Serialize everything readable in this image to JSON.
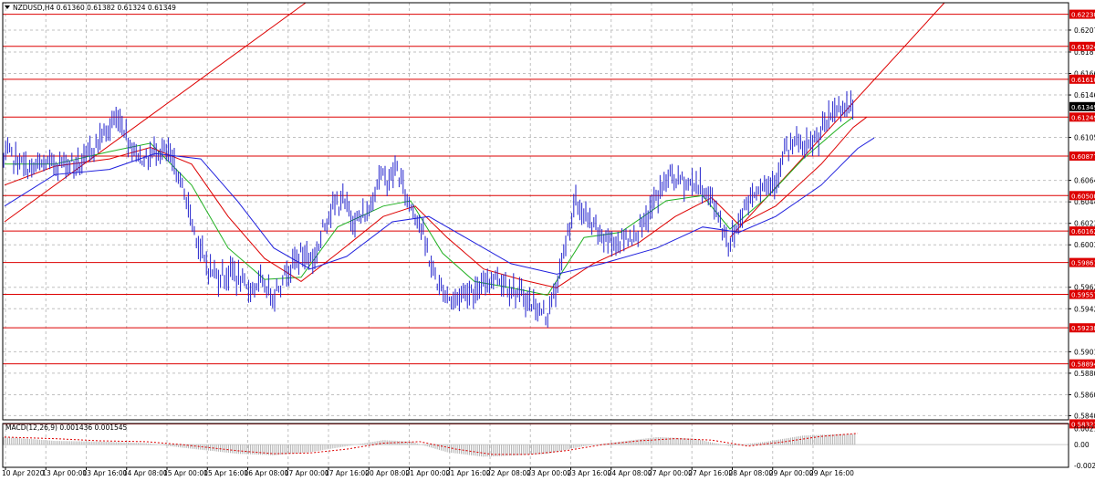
{
  "header": {
    "symbol_line": "NZDUSD,H4  0.61360 0.61382 0.61324 0.61349",
    "macd_label": "MACD(12,26,9) 0.001436 0.001545"
  },
  "colors": {
    "grid": "#c0c0c0",
    "price": "#2222cc",
    "resistance": "#dd0000",
    "ma_fast": "#20b020",
    "ma_mid": "#dd0000",
    "ma_slow": "#2020dd",
    "current_tag": "#000000",
    "macd_hist": "#b0b0b0",
    "macd_signal": "#dd0000"
  },
  "chart_data": [
    {
      "type": "line",
      "title": "NZDUSD,H4",
      "ylim": [
        0.5836,
        0.6234
      ],
      "y_ticks": [
        "0.62079",
        "0.61870",
        "0.61665",
        "0.61460",
        "0.61055",
        "0.60645",
        "0.60440",
        "0.60235",
        "0.60030",
        "0.59625",
        "0.59420",
        "0.59010",
        "0.58805",
        "0.58600",
        "0.58400"
      ],
      "horizontal_levels": [
        "0.62230",
        "0.61924",
        "0.61610",
        "0.61249",
        "0.60877",
        "0.60500",
        "0.60162",
        "0.59861",
        "0.59557",
        "0.59238",
        "0.58894",
        "0.58322"
      ],
      "current_price": "0.61349",
      "x_labels": [
        "10 Apr 2020",
        "13 Apr 00:00",
        "13 Apr 16:00",
        "14 Apr 08:00",
        "15 Apr 00:00",
        "15 Apr 16:00",
        "16 Apr 08:00",
        "17 Apr 00:00",
        "17 Apr 16:00",
        "20 Apr 08:00",
        "21 Apr 00:00",
        "21 Apr 16:00",
        "22 Apr 08:00",
        "23 Apr 00:00",
        "23 Apr 16:00",
        "24 Apr 08:00",
        "27 Apr 00:00",
        "27 Apr 16:00",
        "28 Apr 08:00",
        "29 Apr 00:00",
        "29 Apr 16:00"
      ],
      "price_anchors": [
        [
          0,
          0.608
        ],
        [
          10,
          0.609
        ],
        [
          30,
          0.6075
        ],
        [
          50,
          0.608
        ],
        [
          70,
          0.6082
        ],
        [
          90,
          0.608
        ],
        [
          105,
          0.61
        ],
        [
          120,
          0.6115
        ],
        [
          130,
          0.6125
        ],
        [
          145,
          0.6095
        ],
        [
          160,
          0.6083
        ],
        [
          172,
          0.6095
        ],
        [
          185,
          0.6088
        ],
        [
          200,
          0.606
        ],
        [
          212,
          0.602
        ],
        [
          225,
          0.5985
        ],
        [
          240,
          0.5972
        ],
        [
          255,
          0.5978
        ],
        [
          270,
          0.596
        ],
        [
          285,
          0.5967
        ],
        [
          300,
          0.5955
        ],
        [
          315,
          0.598
        ],
        [
          330,
          0.5995
        ],
        [
          345,
          0.599
        ],
        [
          360,
          0.6035
        ],
        [
          375,
          0.6045
        ],
        [
          390,
          0.6025
        ],
        [
          405,
          0.6035
        ],
        [
          415,
          0.607
        ],
        [
          425,
          0.6065
        ],
        [
          435,
          0.6075
        ],
        [
          445,
          0.605
        ],
        [
          460,
          0.6025
        ],
        [
          470,
          0.599
        ],
        [
          480,
          0.5965
        ],
        [
          495,
          0.595
        ],
        [
          510,
          0.596
        ],
        [
          525,
          0.5958
        ],
        [
          540,
          0.5975
        ],
        [
          555,
          0.5965
        ],
        [
          570,
          0.5955
        ],
        [
          585,
          0.5945
        ],
        [
          598,
          0.5935
        ],
        [
          610,
          0.596
        ],
        [
          620,
          0.6005
        ],
        [
          630,
          0.6045
        ],
        [
          640,
          0.603
        ],
        [
          655,
          0.6015
        ],
        [
          670,
          0.6005
        ],
        [
          690,
          0.601
        ],
        [
          705,
          0.602
        ],
        [
          720,
          0.605
        ],
        [
          735,
          0.607
        ],
        [
          750,
          0.6063
        ],
        [
          765,
          0.606
        ],
        [
          780,
          0.6048
        ],
        [
          790,
          0.6023
        ],
        [
          800,
          0.6003
        ],
        [
          812,
          0.603
        ],
        [
          822,
          0.605
        ],
        [
          835,
          0.606
        ],
        [
          850,
          0.6065
        ],
        [
          860,
          0.609
        ],
        [
          872,
          0.61
        ],
        [
          885,
          0.6095
        ],
        [
          897,
          0.6105
        ],
        [
          910,
          0.6125
        ],
        [
          920,
          0.6135
        ],
        [
          935,
          0.6134
        ]
      ],
      "moving_averages": {
        "fast": [
          [
            5,
            0.608
          ],
          [
            60,
            0.608
          ],
          [
            120,
            0.6092
          ],
          [
            165,
            0.61
          ],
          [
            210,
            0.606
          ],
          [
            250,
            0.6
          ],
          [
            290,
            0.597
          ],
          [
            330,
            0.5972
          ],
          [
            370,
            0.602
          ],
          [
            420,
            0.604
          ],
          [
            450,
            0.6045
          ],
          [
            485,
            0.5995
          ],
          [
            520,
            0.5968
          ],
          [
            560,
            0.5962
          ],
          [
            600,
            0.5955
          ],
          [
            640,
            0.601
          ],
          [
            680,
            0.6015
          ],
          [
            730,
            0.6045
          ],
          [
            770,
            0.605
          ],
          [
            800,
            0.6018
          ],
          [
            840,
            0.6048
          ],
          [
            880,
            0.6085
          ],
          [
            920,
            0.6115
          ],
          [
            935,
            0.6125
          ]
        ],
        "mid": [
          [
            5,
            0.606
          ],
          [
            60,
            0.6078
          ],
          [
            120,
            0.6085
          ],
          [
            165,
            0.6096
          ],
          [
            210,
            0.608
          ],
          [
            250,
            0.603
          ],
          [
            290,
            0.599
          ],
          [
            330,
            0.5968
          ],
          [
            370,
            0.5995
          ],
          [
            420,
            0.603
          ],
          [
            455,
            0.604
          ],
          [
            490,
            0.601
          ],
          [
            530,
            0.598
          ],
          [
            570,
            0.597
          ],
          [
            610,
            0.5962
          ],
          [
            650,
            0.5985
          ],
          [
            700,
            0.6005
          ],
          [
            740,
            0.603
          ],
          [
            780,
            0.6048
          ],
          [
            810,
            0.6022
          ],
          [
            850,
            0.604
          ],
          [
            900,
            0.608
          ],
          [
            935,
            0.6115
          ],
          [
            950,
            0.6125
          ]
        ],
        "slow": [
          [
            5,
            0.604
          ],
          [
            60,
            0.607
          ],
          [
            120,
            0.6075
          ],
          [
            170,
            0.609
          ],
          [
            220,
            0.6085
          ],
          [
            260,
            0.6045
          ],
          [
            300,
            0.6
          ],
          [
            340,
            0.598
          ],
          [
            380,
            0.5992
          ],
          [
            430,
            0.6025
          ],
          [
            470,
            0.603
          ],
          [
            510,
            0.601
          ],
          [
            560,
            0.5985
          ],
          [
            610,
            0.5975
          ],
          [
            660,
            0.5985
          ],
          [
            720,
            0.6
          ],
          [
            770,
            0.602
          ],
          [
            810,
            0.6015
          ],
          [
            850,
            0.603
          ],
          [
            900,
            0.606
          ],
          [
            940,
            0.6095
          ],
          [
            958,
            0.6105
          ]
        ]
      },
      "trendlines": [
        {
          "from": [
            5,
            0.6025
          ],
          "to": [
            335,
            0.6234
          ]
        },
        {
          "from": [
            800,
            0.601
          ],
          "to": [
            1035,
            0.6234
          ]
        }
      ]
    },
    {
      "type": "bar",
      "title": "MACD(12,26,9)",
      "ylim": [
        -0.003,
        0.0028
      ],
      "y_ticks": [
        "0.002132",
        "0.00",
        "-0.002751"
      ],
      "histogram_anchors": [
        [
          5,
          0.001
        ],
        [
          60,
          0.0005
        ],
        [
          110,
          0.0004
        ],
        [
          160,
          0.0002
        ],
        [
          200,
          -0.0004
        ],
        [
          260,
          -0.0012
        ],
        [
          300,
          -0.0014
        ],
        [
          340,
          -0.001
        ],
        [
          380,
          -0.0002
        ],
        [
          420,
          0.0006
        ],
        [
          450,
          0.0004
        ],
        [
          490,
          -0.001
        ],
        [
          530,
          -0.0016
        ],
        [
          570,
          -0.0014
        ],
        [
          600,
          -0.0012
        ],
        [
          640,
          -0.0002
        ],
        [
          680,
          0.0004
        ],
        [
          720,
          0.001
        ],
        [
          760,
          0.0008
        ],
        [
          800,
          -0.0002
        ],
        [
          840,
          0.0004
        ],
        [
          880,
          0.0012
        ],
        [
          920,
          0.0014
        ],
        [
          935,
          0.0014
        ]
      ],
      "signal_anchors": [
        [
          5,
          0.001
        ],
        [
          60,
          0.0008
        ],
        [
          110,
          0.0005
        ],
        [
          160,
          0.0004
        ],
        [
          200,
          0.0
        ],
        [
          260,
          -0.0008
        ],
        [
          300,
          -0.0012
        ],
        [
          340,
          -0.0011
        ],
        [
          380,
          -0.0006
        ],
        [
          420,
          0.0002
        ],
        [
          460,
          0.0004
        ],
        [
          500,
          -0.0006
        ],
        [
          540,
          -0.0013
        ],
        [
          580,
          -0.0013
        ],
        [
          620,
          -0.0008
        ],
        [
          660,
          0.0
        ],
        [
          700,
          0.0005
        ],
        [
          740,
          0.0008
        ],
        [
          780,
          0.0006
        ],
        [
          820,
          -0.0002
        ],
        [
          860,
          0.0004
        ],
        [
          900,
          0.0011
        ],
        [
          940,
          0.0015
        ]
      ]
    }
  ]
}
